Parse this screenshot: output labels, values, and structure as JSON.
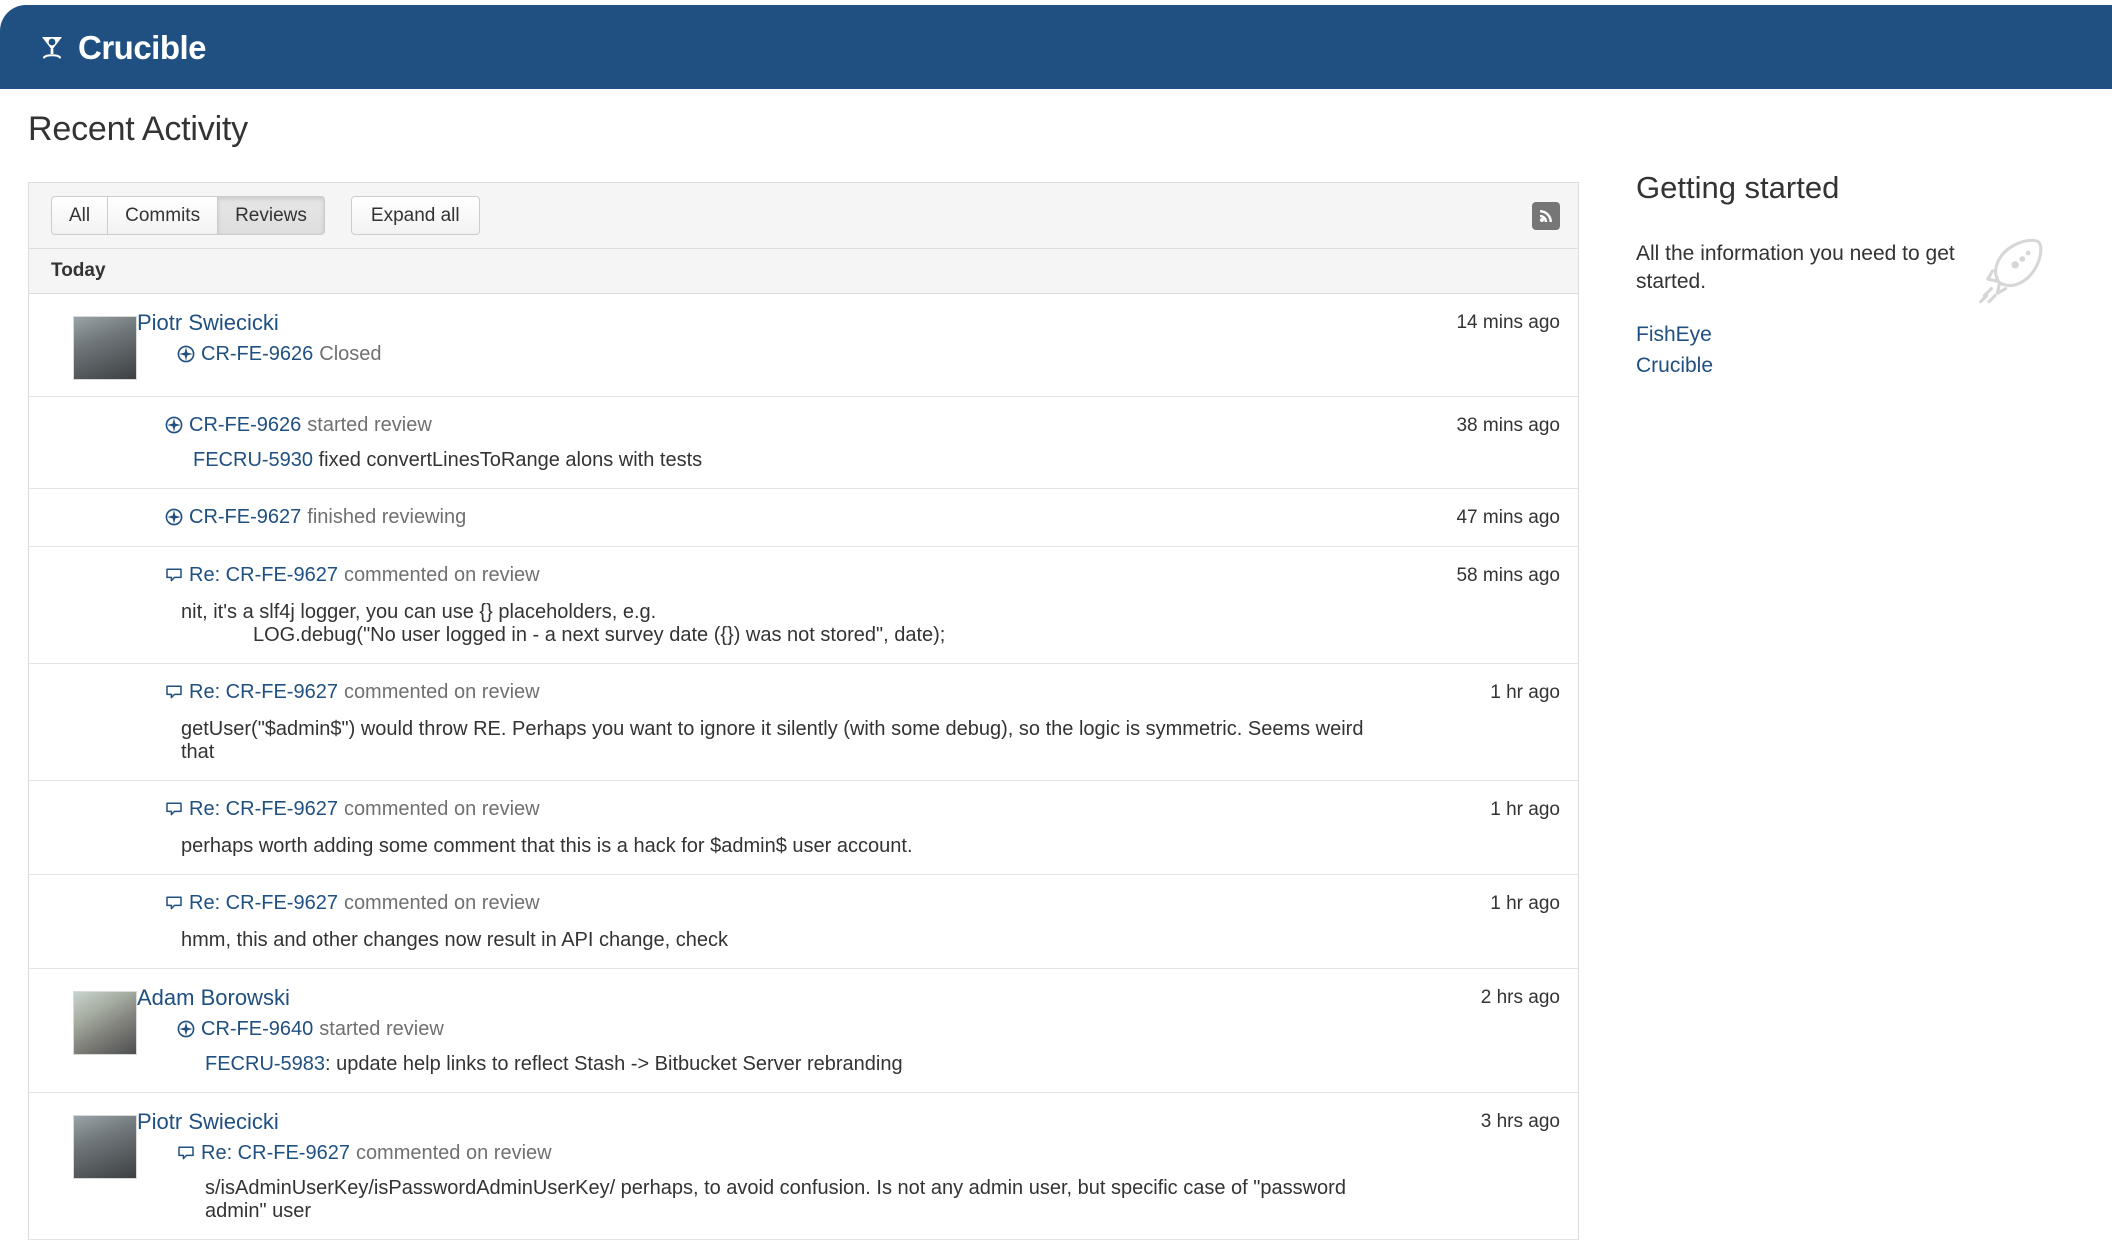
{
  "header": {
    "brand_name": "Crucible",
    "logo_icon": "crucible-logo-icon",
    "bg_color": "#205081"
  },
  "page": {
    "title": "Recent Activity"
  },
  "toolbar": {
    "filters": [
      {
        "label": "All",
        "pressed": false
      },
      {
        "label": "Commits",
        "pressed": false
      },
      {
        "label": "Reviews",
        "pressed": true
      }
    ],
    "expand_all_label": "Expand all",
    "feed_icon": "rss-feed-icon"
  },
  "activity": {
    "day_label": "Today",
    "rows": [
      {
        "type": "actor",
        "actor": "Piotr Swiecicki",
        "icon": "review-target-icon",
        "entity_id": "CR-FE-9626",
        "verb": "Closed",
        "time": "14 mins ago"
      },
      {
        "type": "sub",
        "icon": "review-target-icon",
        "entity_id": "CR-FE-9626",
        "verb": "started review",
        "time": "38 mins ago",
        "detail_link": "FECRU-5930",
        "detail_text": "fixed convertLinesToRange alons with tests"
      },
      {
        "type": "sub",
        "icon": "review-target-icon",
        "entity_id": "CR-FE-9627",
        "verb": "finished reviewing",
        "time": "47 mins ago"
      },
      {
        "type": "sub",
        "icon": "comment-bubble-icon",
        "entity_id": "Re: CR-FE-9627",
        "verb": "commented on review",
        "time": "58 mins ago",
        "comment": "nit, it's a slf4j logger, you can use {} placeholders, e.g.",
        "comment_code": "LOG.debug(\"No user logged in - a next survey date ({}) was not stored\", date);"
      },
      {
        "type": "sub",
        "icon": "comment-bubble-icon",
        "entity_id": "Re: CR-FE-9627",
        "verb": "commented on review",
        "time": "1 hr ago",
        "comment": "getUser(\"$admin$\") would throw RE. Perhaps you want to ignore it silently (with some debug), so the logic is symmetric. Seems weird that"
      },
      {
        "type": "sub",
        "icon": "comment-bubble-icon",
        "entity_id": "Re: CR-FE-9627",
        "verb": "commented on review",
        "time": "1 hr ago",
        "comment": "perhaps worth adding some comment that this is a hack for $admin$ user account."
      },
      {
        "type": "sub",
        "icon": "comment-bubble-icon",
        "entity_id": "Re: CR-FE-9627",
        "verb": "commented on review",
        "time": "1 hr ago",
        "comment": "hmm, this and other changes now result in API change, check"
      },
      {
        "type": "actor",
        "actor": "Adam Borowski",
        "icon": "review-target-icon",
        "entity_id": "CR-FE-9640",
        "verb": "started review",
        "time": "2 hrs ago",
        "detail_link": "FECRU-5983",
        "detail_text": ": update help links to reflect Stash -> Bitbucket Server rebranding"
      },
      {
        "type": "actor",
        "actor": "Piotr Swiecicki",
        "icon": "comment-bubble-icon",
        "entity_id": "Re: CR-FE-9627",
        "verb": "commented on review",
        "time": "3 hrs ago",
        "comment": "s/isAdminUserKey/isPasswordAdminUserKey/ perhaps, to avoid confusion. Is not any admin user, but specific case of \"password admin\" user"
      }
    ]
  },
  "sidebar": {
    "title": "Getting started",
    "description": "All the information you need to get started.",
    "icon": "rocket-icon",
    "links": [
      {
        "label": "FishEye"
      },
      {
        "label": "Crucible"
      }
    ]
  },
  "colors": {
    "brand_blue": "#205081",
    "link_blue": "#205081",
    "muted_gray": "#707070",
    "panel_border": "#dddddd"
  }
}
